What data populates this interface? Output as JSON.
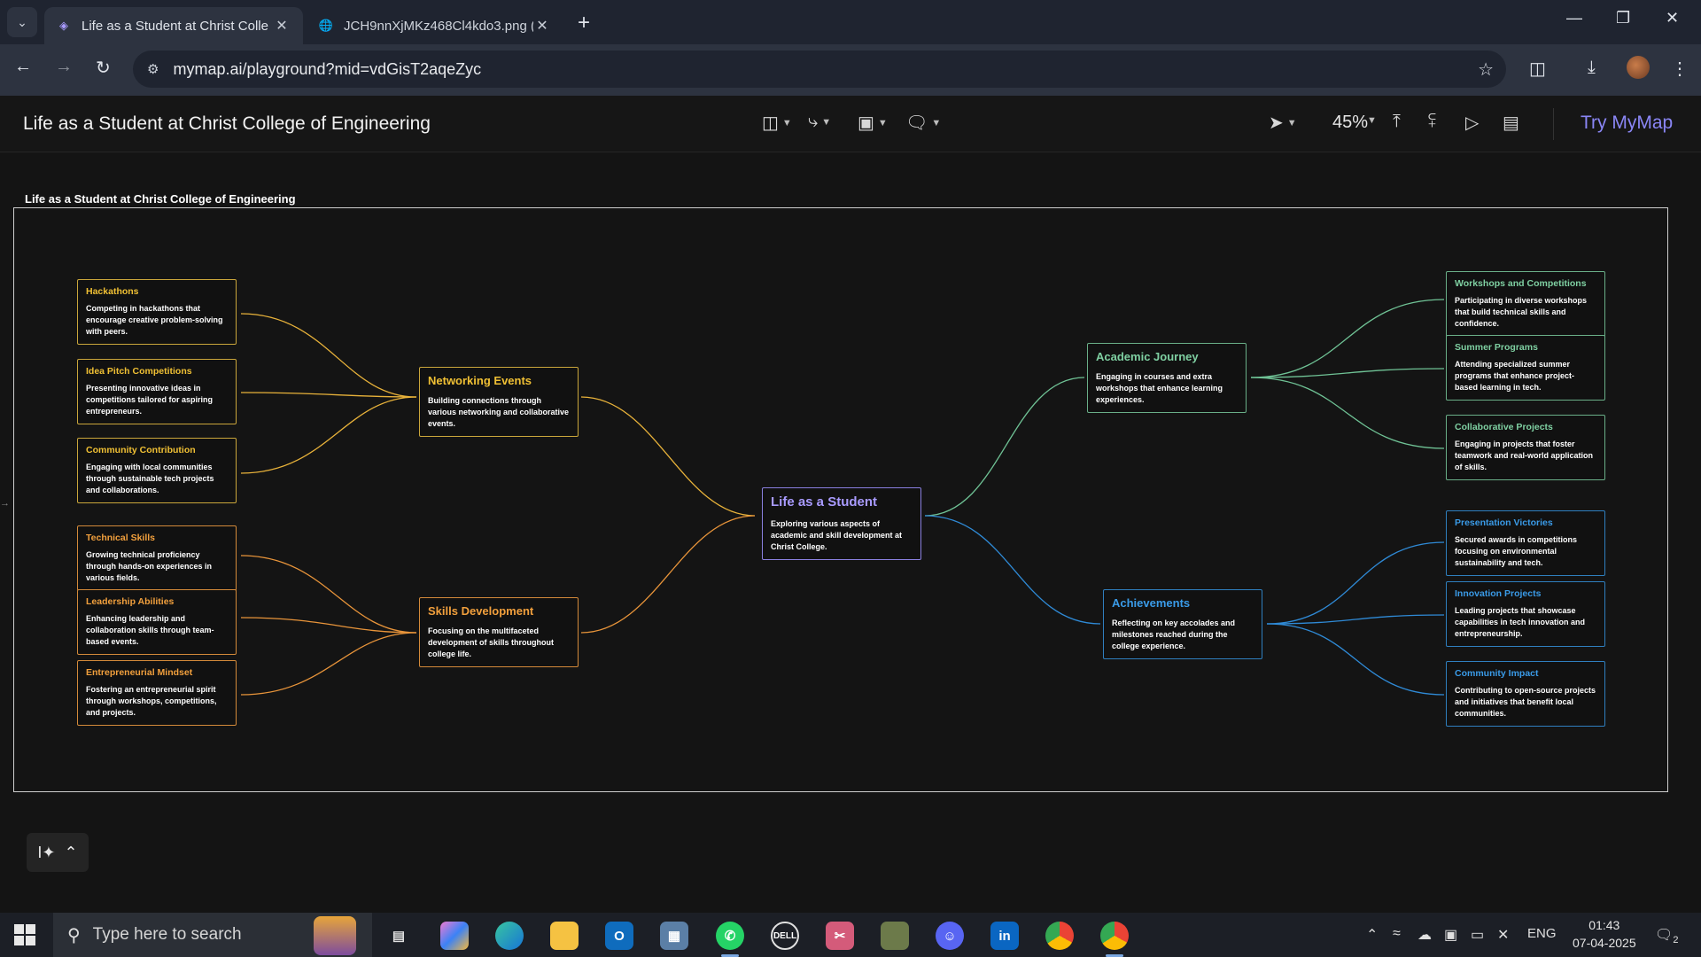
{
  "browser": {
    "tabs": [
      {
        "title": "Life as a Student at Christ Colle",
        "active": true
      },
      {
        "title": "JCH9nnXjMKz468Cl4kdo3.png (",
        "active": false
      }
    ],
    "new_tab": "+",
    "url": "mymap.ai/playground?mid=vdGisT2aqeZyc"
  },
  "app": {
    "title": "Life as a Student at Christ College of Engineering",
    "zoom": "45%",
    "cta": "Try MyMap"
  },
  "canvas": {
    "frame_label": "Life as a Student at Christ College of Engineering",
    "root": {
      "title": "Life as a Student",
      "desc": "Exploring various aspects of academic and skill development at Christ College."
    },
    "branches": {
      "networking": {
        "title": "Networking Events",
        "desc": "Building connections through various networking and collaborative events."
      },
      "skills": {
        "title": "Skills Development",
        "desc": "Focusing on the multifaceted development of skills throughout college life."
      },
      "academic": {
        "title": "Academic Journey",
        "desc": "Engaging in courses and extra workshops that enhance learning experiences."
      },
      "achievements": {
        "title": "Achievements",
        "desc": "Reflecting on key accolades and milestones reached during the college experience."
      }
    },
    "leaves": {
      "hackathons": {
        "title": "Hackathons",
        "desc": "Competing in hackathons that encourage creative problem-solving with peers."
      },
      "idea_pitch": {
        "title": "Idea Pitch Competitions",
        "desc": "Presenting innovative ideas in competitions tailored for aspiring entrepreneurs."
      },
      "community_contribution": {
        "title": "Community Contribution",
        "desc": "Engaging with local communities through sustainable tech projects and collaborations."
      },
      "technical_skills": {
        "title": "Technical Skills",
        "desc": "Growing technical proficiency through hands-on experiences in various fields."
      },
      "leadership": {
        "title": "Leadership Abilities",
        "desc": "Enhancing leadership and collaboration skills through team-based events."
      },
      "entrepreneurial": {
        "title": "Entrepreneurial Mindset",
        "desc": "Fostering an entrepreneurial spirit through workshops, competitions, and projects."
      },
      "workshops": {
        "title": "Workshops and Competitions",
        "desc": "Participating in diverse workshops that build technical skills and confidence."
      },
      "summer": {
        "title": "Summer Programs",
        "desc": "Attending specialized summer programs that enhance project-based learning in tech."
      },
      "collaborative": {
        "title": "Collaborative Projects",
        "desc": "Engaging in projects that foster teamwork and real-world application of skills."
      },
      "presentation": {
        "title": "Presentation Victories",
        "desc": "Secured awards in competitions focusing on environmental sustainability and tech."
      },
      "innovation": {
        "title": "Innovation Projects",
        "desc": "Leading projects that showcase capabilities in tech innovation and entrepreneurship."
      },
      "community_impact": {
        "title": "Community Impact",
        "desc": "Contributing to open-source projects and initiatives that benefit local communities."
      }
    },
    "colors": {
      "networking": "#e8b23a",
      "skills": "#e8943a",
      "academic": "#6fc295",
      "achievements": "#2f8ad6",
      "root": "#a99bff"
    }
  },
  "taskbar": {
    "search_placeholder": "Type here to search",
    "lang": "ENG",
    "time": "01:43",
    "date": "07-04-2025",
    "notifications": "2"
  }
}
